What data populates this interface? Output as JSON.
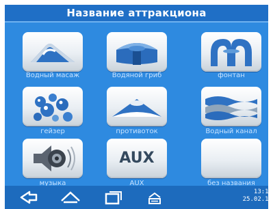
{
  "title": "Название аттракциона",
  "tiles": [
    {
      "label": "Водный масаж",
      "icon": "water-massage-icon"
    },
    {
      "label": "Водяной гриб",
      "icon": "water-mushroom-icon"
    },
    {
      "label": "фонтан",
      "icon": "fountain-icon"
    },
    {
      "label": "гейзер",
      "icon": "geyser-icon"
    },
    {
      "label": "противоток",
      "icon": "counterflow-icon"
    },
    {
      "label": "Водный канал",
      "icon": "water-channel-icon"
    },
    {
      "label": "музыка",
      "icon": "music-speaker-icon"
    },
    {
      "label": "AUX",
      "icon": "aux-icon",
      "text": "AUX"
    },
    {
      "label": "без названия",
      "icon": "blank-icon"
    }
  ],
  "nav": {
    "back_icon": "back-icon",
    "home_icon": "home-icon",
    "recent_icon": "recent-apps-icon",
    "menu_icon": "menu-icon"
  },
  "clock": {
    "time": "13:11",
    "date": "25.02.14"
  },
  "colors": {
    "screen": "#2e8ae0",
    "titlebar": "#1f6fc6",
    "bottombar": "#1d6bbd",
    "label": "#c9e3ff",
    "icon_blue": "#2a6fc0"
  }
}
